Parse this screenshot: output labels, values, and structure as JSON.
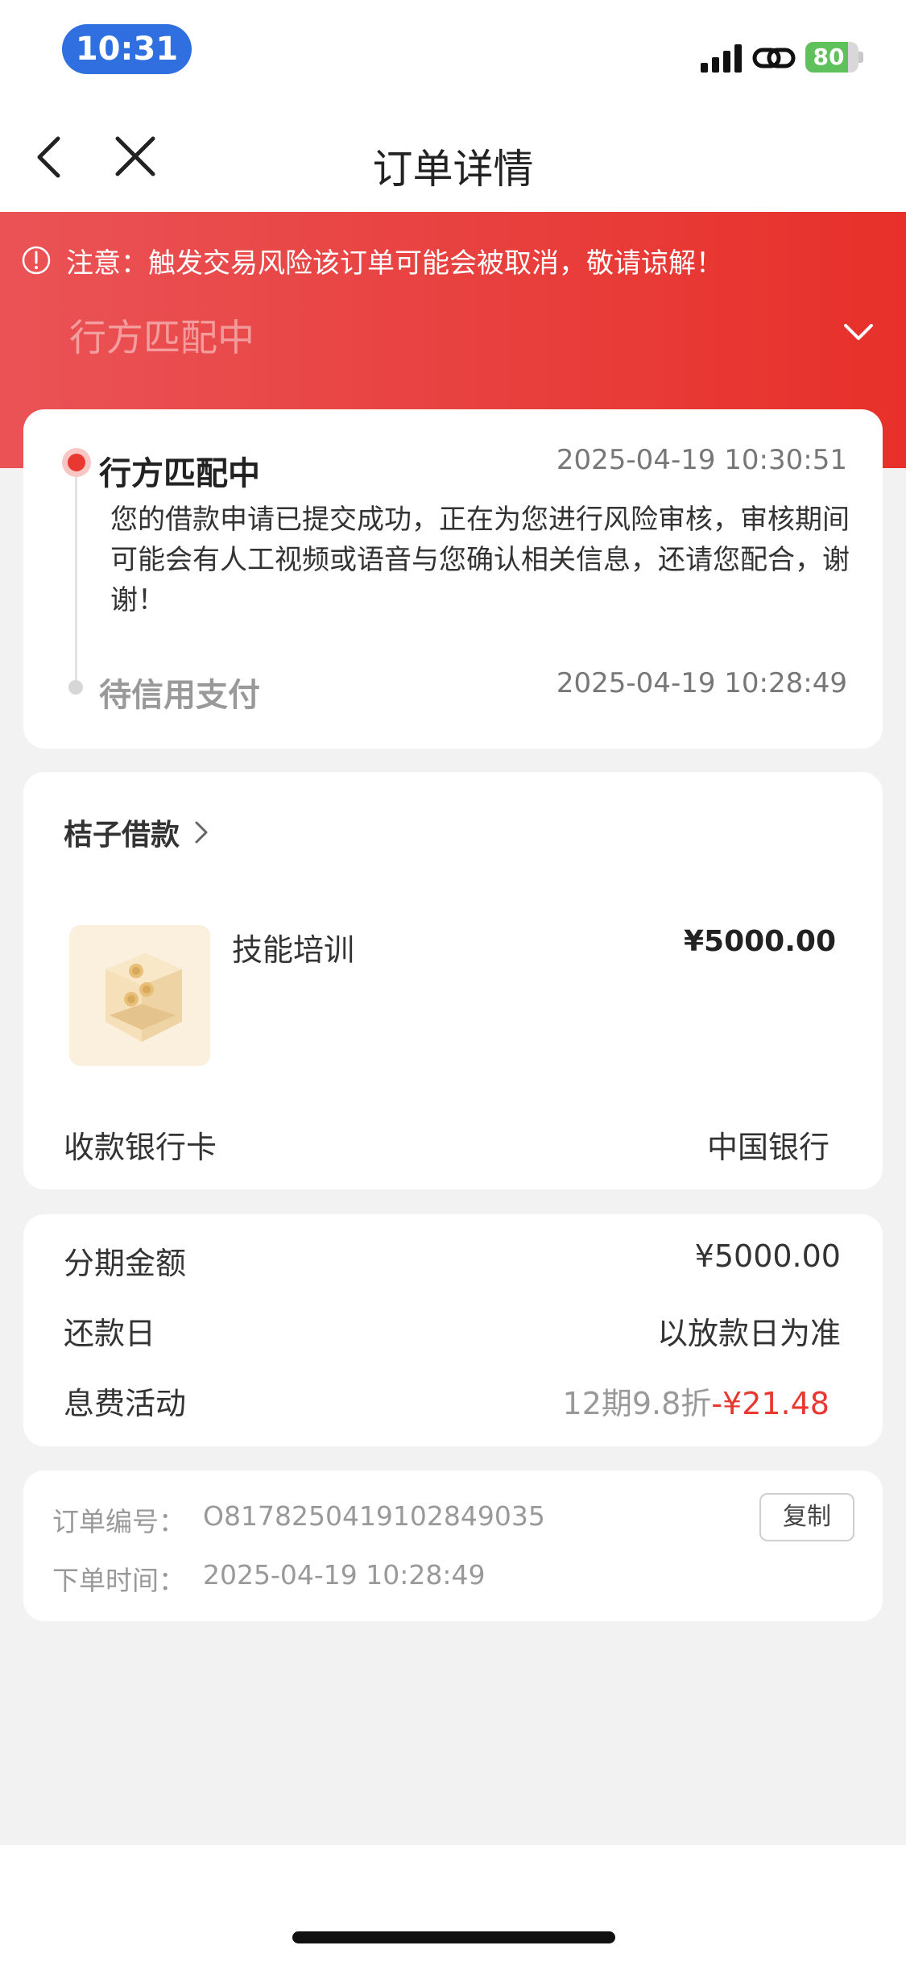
{
  "status_bar": {
    "time": "10:31",
    "battery_level": "80",
    "battery_fraction": 0.8,
    "icons": [
      "signal-icon",
      "link-icon",
      "battery-charging-icon"
    ]
  },
  "nav": {
    "title": "订单详情",
    "icons": [
      "back-chevron-icon",
      "close-icon"
    ]
  },
  "banner": {
    "warning": "注意：触发交易风险该订单可能会被取消，敬请谅解！",
    "status": "行方匹配中",
    "icons": [
      "warning-circle-icon",
      "chevron-down-icon"
    ]
  },
  "timeline": [
    {
      "title": "行方匹配中",
      "time": "2025-04-19 10:30:51",
      "description": "您的借款申请已提交成功，正在为您进行风险审核，审核期间可能会有人工视频或语音与您确认相关信息，还请您配合，谢谢！"
    },
    {
      "title": "待信用支付",
      "time": "2025-04-19 10:28:49"
    }
  ],
  "merchant": {
    "name": "桔子借款",
    "product_name": "技能培训",
    "product_price": "¥5000.00",
    "bank_label": "收款银行卡",
    "bank_value": "中国银行",
    "product_image_icon": "coin-box-icon"
  },
  "installment": {
    "amount_label": "分期金额",
    "amount_value": "¥5000.00",
    "repay_label": "还款日",
    "repay_value": "以放款日为准",
    "promo_label": "息费活动",
    "promo_text": "12期9.8折",
    "promo_amount": "-¥21.48"
  },
  "order": {
    "number_label": "订单编号：",
    "number_value": "O8178250419102849035",
    "copy_label": "复制",
    "time_label": "下单时间：",
    "time_value": "2025-04-19 10:28:49"
  },
  "colors": {
    "accent_red": "#e8382f",
    "time_pill_blue": "#2f6fe0",
    "battery_green": "#5ec15c"
  }
}
